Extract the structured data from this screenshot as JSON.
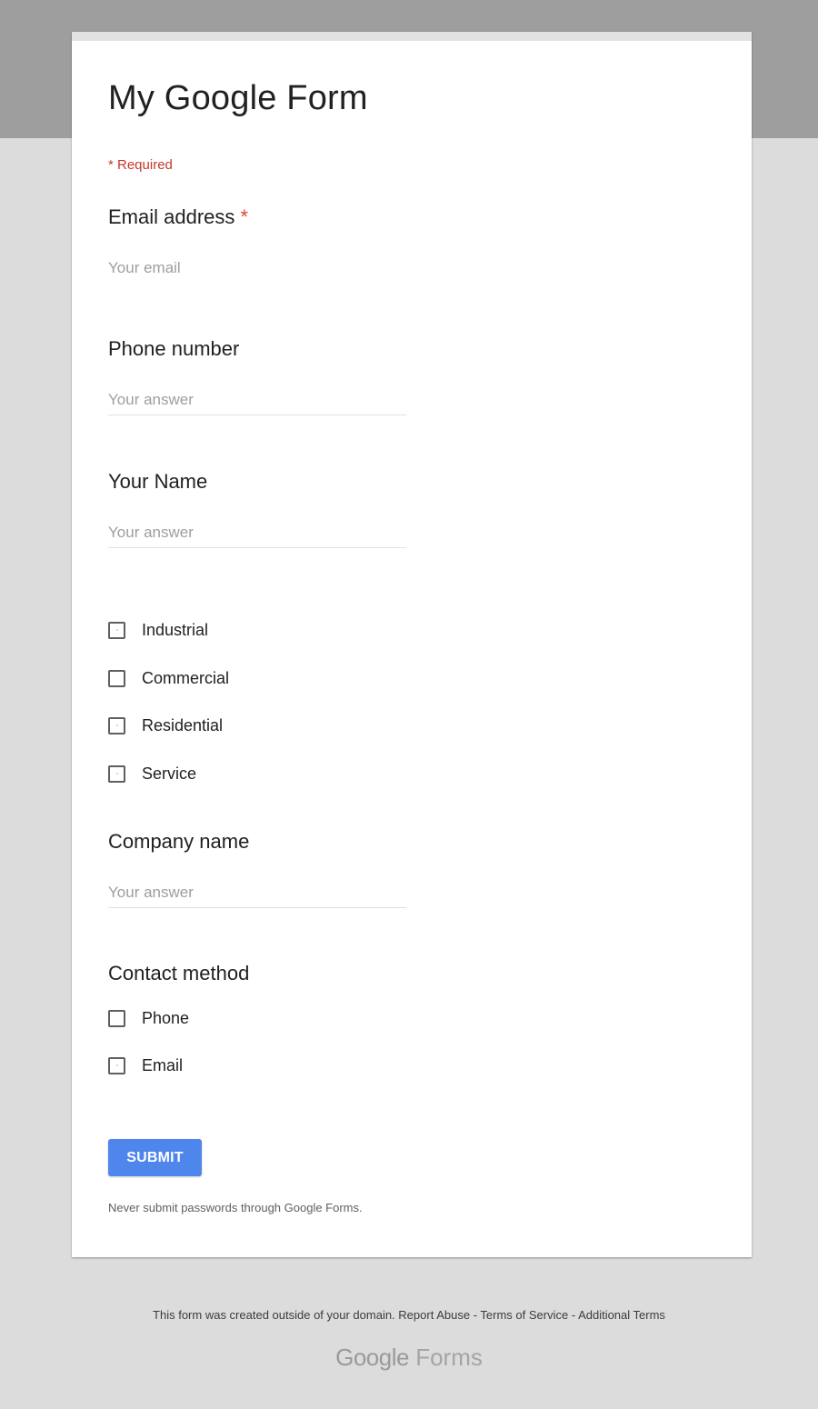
{
  "form": {
    "title": "My Google Form",
    "required_note": "* Required"
  },
  "questions": {
    "email": {
      "label": "Email address",
      "required_mark": "*",
      "placeholder": "Your email",
      "value": ""
    },
    "phone": {
      "label": "Phone number",
      "placeholder": "Your answer",
      "value": ""
    },
    "name": {
      "label": "Your Name",
      "placeholder": "Your answer",
      "value": ""
    },
    "category": {
      "options": [
        {
          "label": "Industrial",
          "checked": false
        },
        {
          "label": "Commercial",
          "checked": false
        },
        {
          "label": "Residential",
          "checked": false
        },
        {
          "label": "Service",
          "checked": false
        }
      ]
    },
    "company": {
      "label": "Company name",
      "placeholder": "Your answer",
      "value": ""
    },
    "contact_method": {
      "label": "Contact method",
      "options": [
        {
          "label": "Phone",
          "checked": false
        },
        {
          "label": "Email",
          "checked": false
        }
      ]
    }
  },
  "actions": {
    "submit_label": "SUBMIT",
    "password_note": "Never submit passwords through Google Forms."
  },
  "footer": {
    "notice": "This form was created outside of your domain.",
    "report_abuse": "Report Abuse",
    "separator": " - ",
    "terms_of_service": "Terms of Service",
    "additional_terms": "Additional Terms",
    "brand_google": "Google",
    "brand_forms": "Forms"
  },
  "colors": {
    "accent": "#4f86ec",
    "required": "#c53929",
    "header_band": "#9e9e9e",
    "page_background": "#dcdcdc"
  }
}
